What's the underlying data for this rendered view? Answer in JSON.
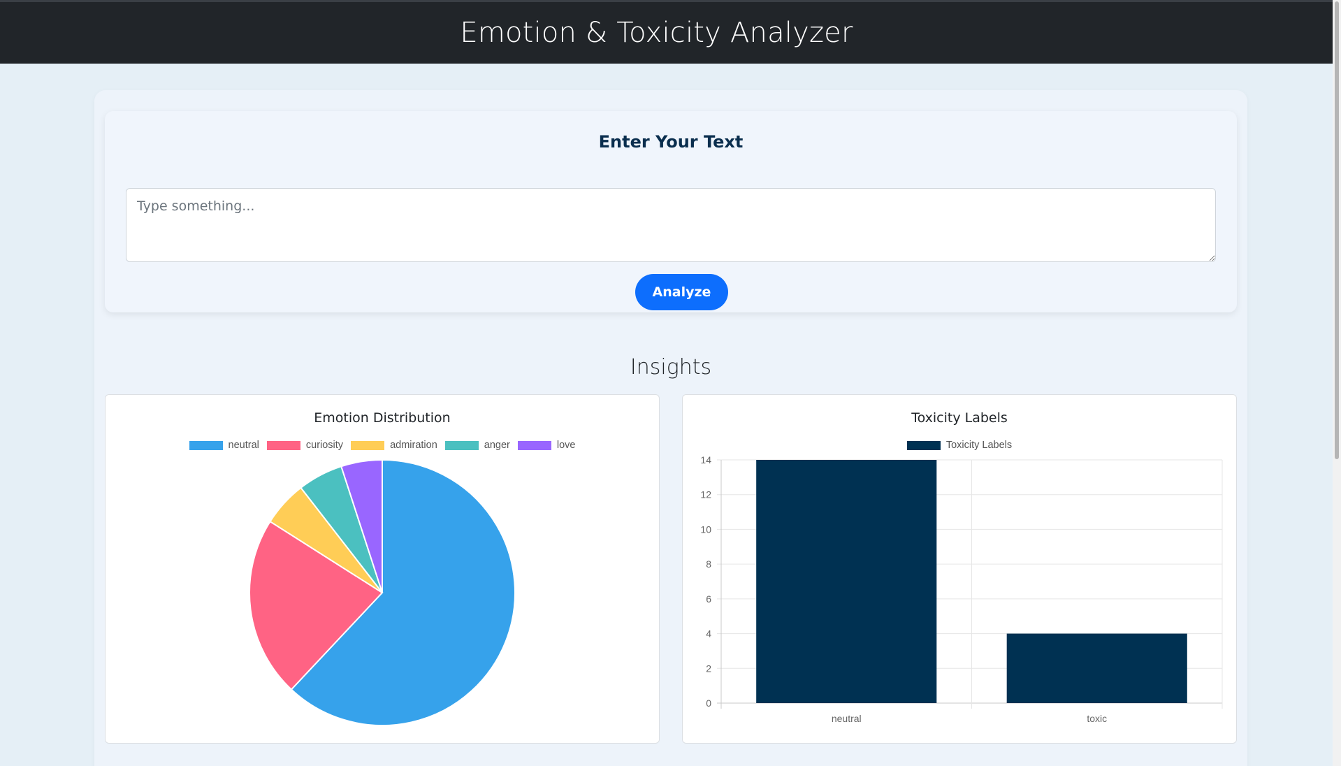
{
  "header": {
    "title": "Emotion & Toxicity Analyzer",
    "background": "#212529"
  },
  "input_card": {
    "heading": "Enter Your Text",
    "textarea_value": "",
    "textarea_placeholder": "Type something...",
    "analyze_label": "Analyze",
    "accent": "#0d6efd"
  },
  "insights": {
    "title": "Insights"
  },
  "chart_data": [
    {
      "type": "pie",
      "title": "Emotion Distribution",
      "categories": [
        "neutral",
        "curiosity",
        "admiration",
        "anger",
        "love"
      ],
      "values": [
        62,
        22,
        5.5,
        5.5,
        5
      ],
      "colors": [
        "#36a2eb",
        "#ff6384",
        "#ffcd56",
        "#4bc0c0",
        "#9966ff"
      ],
      "legend_position": "top"
    },
    {
      "type": "bar",
      "title": "Toxicity Labels",
      "categories": [
        "neutral",
        "toxic"
      ],
      "series": [
        {
          "name": "Toxicity Labels",
          "values": [
            14,
            4
          ],
          "color": "#003152"
        }
      ],
      "ylim": [
        0,
        14
      ],
      "yticks": [
        0,
        2,
        4,
        6,
        8,
        10,
        12,
        14
      ],
      "grid": true,
      "legend_position": "top"
    }
  ]
}
